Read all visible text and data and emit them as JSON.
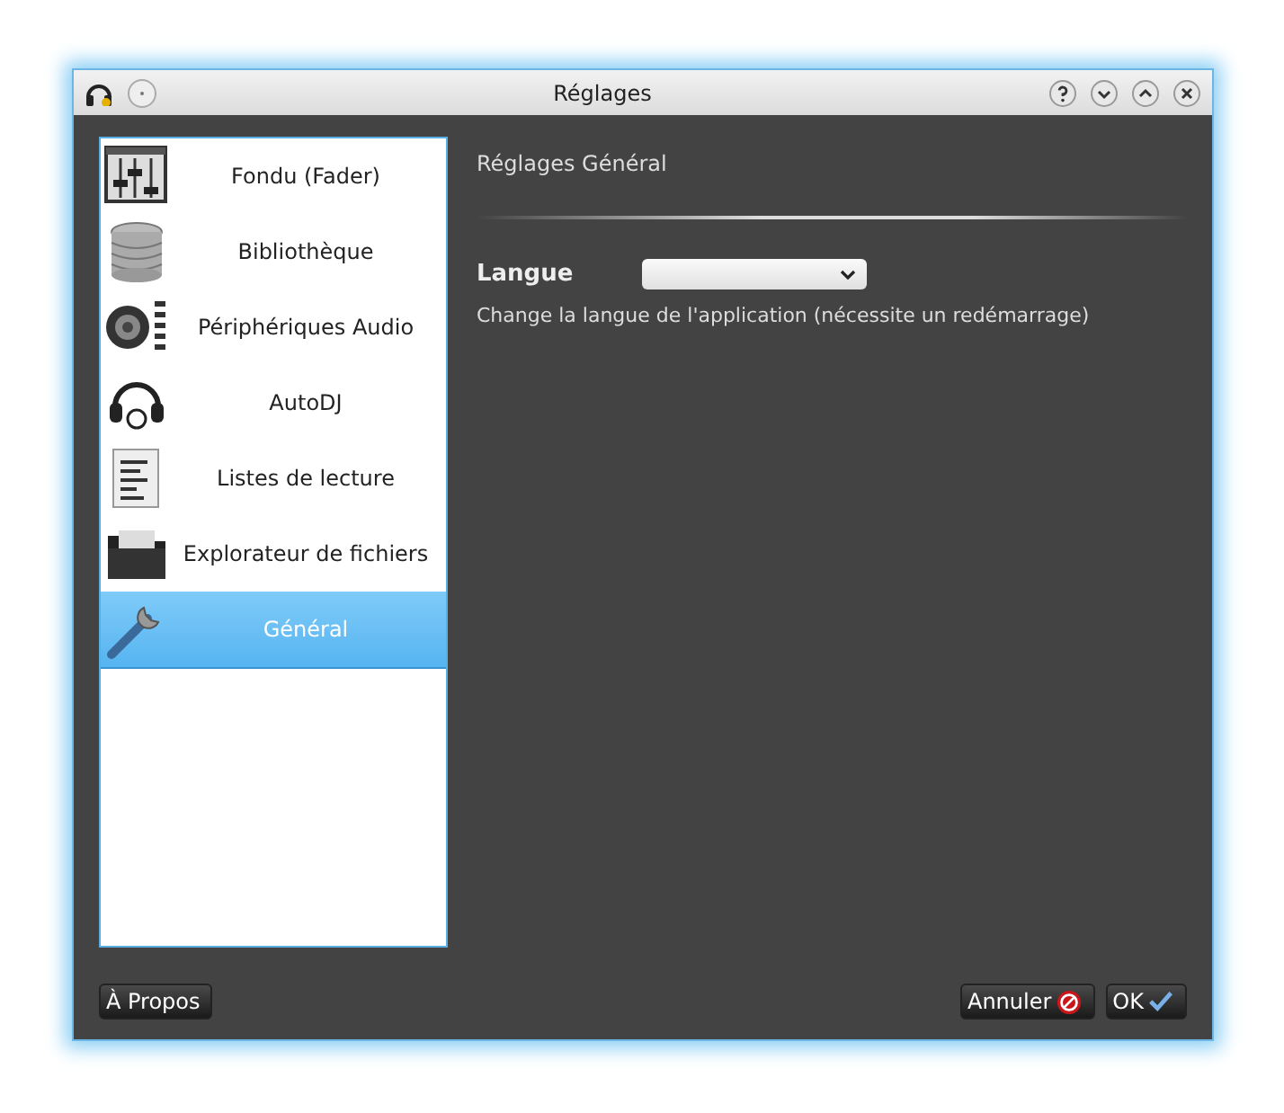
{
  "window": {
    "title": "Réglages"
  },
  "sidebar": {
    "items": [
      {
        "label": "Fondu (Fader)",
        "kind": "fader",
        "selected": false
      },
      {
        "label": "Bibliothèque",
        "kind": "library",
        "selected": false
      },
      {
        "label": "Périphériques Audio",
        "kind": "speaker",
        "selected": false
      },
      {
        "label": "AutoDJ",
        "kind": "headphones",
        "selected": false
      },
      {
        "label": "Listes de lecture",
        "kind": "document",
        "selected": false
      },
      {
        "label": "Explorateur de fichiers",
        "kind": "folder",
        "selected": false
      },
      {
        "label": "Général",
        "kind": "wrench",
        "selected": true
      }
    ]
  },
  "panel": {
    "heading": "Réglages Général",
    "language": {
      "label": "Langue",
      "hint": "Change la langue de l'application (nécessite un redémarrage)"
    }
  },
  "buttons": {
    "about": "À Propos",
    "cancel": "Annuler",
    "ok": "OK"
  }
}
